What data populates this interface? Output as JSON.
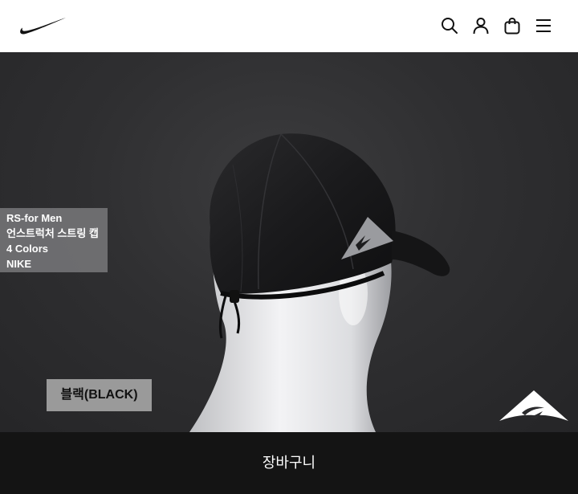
{
  "header": {
    "logo": "nike-swoosh-logo",
    "icons": [
      "search-icon",
      "user-icon",
      "bag-icon",
      "menu-icon"
    ]
  },
  "product": {
    "line1": "RS-for Men",
    "line2": "언스트럭처 스트링 캡",
    "line3": "4 Colors",
    "line4": "NIKE"
  },
  "color_label": "블랙(BLACK)",
  "cart_button": "장바구니",
  "colors": {
    "header_bg": "#ffffff",
    "hero_bg": "#2b2b2d",
    "bottom_bar": "#141414"
  }
}
